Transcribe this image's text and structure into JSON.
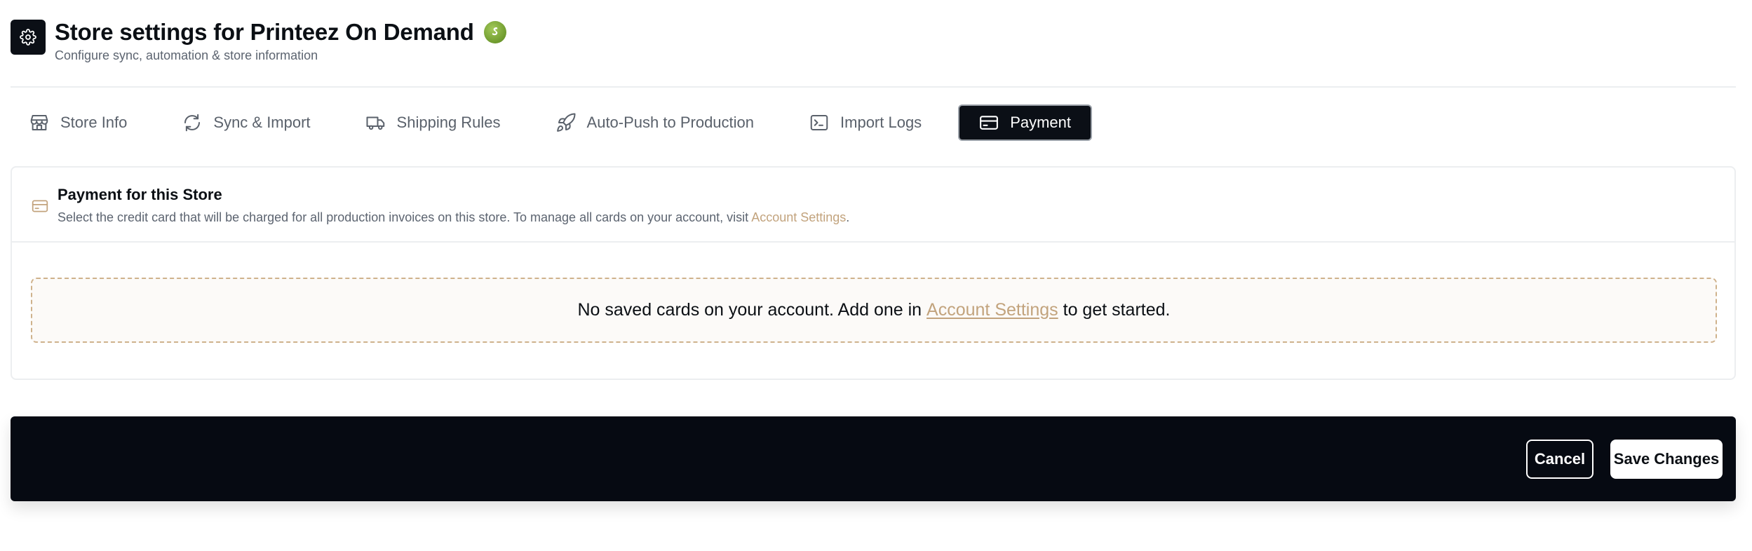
{
  "header": {
    "title": "Store settings for Printeez On Demand",
    "subtitle": "Configure sync, automation & store information",
    "settings_icon": "gear-icon",
    "platform_badge": "shopify-icon"
  },
  "tabs": [
    {
      "label": "Store Info",
      "icon": "storefront-icon",
      "active": false
    },
    {
      "label": "Sync & Import",
      "icon": "refresh-icon",
      "active": false
    },
    {
      "label": "Shipping Rules",
      "icon": "truck-icon",
      "active": false
    },
    {
      "label": "Auto-Push to Production",
      "icon": "rocket-icon",
      "active": false
    },
    {
      "label": "Import Logs",
      "icon": "terminal-icon",
      "active": false
    },
    {
      "label": "Payment",
      "icon": "credit-card-icon",
      "active": true
    }
  ],
  "payment": {
    "title": "Payment for this Store",
    "description_prefix": "Select the credit card that will be charged for all production invoices on this store. To manage all cards on your account, visit ",
    "description_link": "Account Settings",
    "description_suffix": ".",
    "empty_prefix": "No saved cards on your account. Add one in ",
    "empty_link": "Account Settings",
    "empty_suffix": " to get started."
  },
  "footer": {
    "cancel_label": "Cancel",
    "save_label": "Save Changes"
  },
  "colors": {
    "dark": "#0b0f16",
    "accent_link": "#c2a37d",
    "muted_text": "#5c6470",
    "border": "#eceef0"
  }
}
